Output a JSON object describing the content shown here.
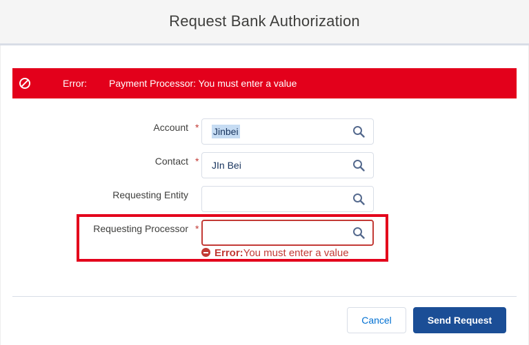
{
  "modal": {
    "title": "Request Bank Authorization"
  },
  "error_banner": {
    "icon": "ban-icon",
    "prefix": "Error:",
    "message": "Payment Processor: You must enter a value",
    "color": "#e3001b"
  },
  "fields": [
    {
      "label": "Account",
      "required": true,
      "required_marker": "*",
      "value": "Jinbei",
      "value_selected": true,
      "icon": "search-icon"
    },
    {
      "label": "Contact",
      "required": true,
      "required_marker": "*",
      "value": "JIn Bei",
      "icon": "search-icon"
    },
    {
      "label": "Requesting Entity",
      "required": false,
      "value": "",
      "icon": "search-icon"
    },
    {
      "label": "Requesting Processor",
      "required": true,
      "required_marker": "*",
      "value": "",
      "icon": "search-icon",
      "has_error": true
    }
  ],
  "field_error": {
    "icon": "error-minus-icon",
    "prefix": "Error:",
    "message": "You must enter a value",
    "color": "#c23934"
  },
  "footer": {
    "cancel_label": "Cancel",
    "send_label": "Send Request",
    "send_color": "#1b4e96"
  }
}
